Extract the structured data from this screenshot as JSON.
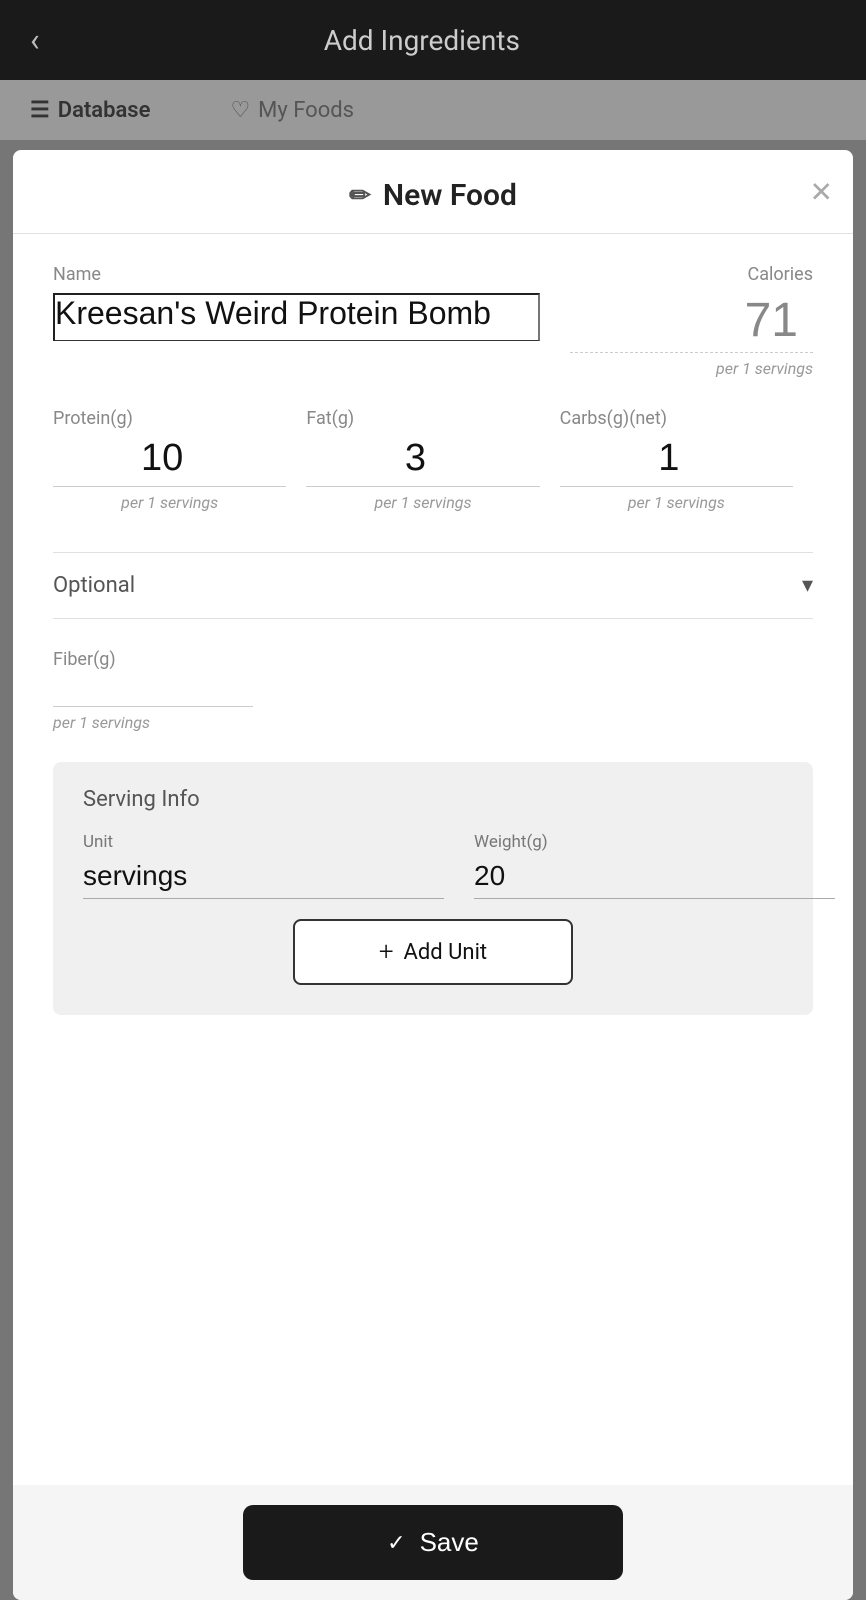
{
  "topBar": {
    "backLabel": "‹",
    "title": "Add Ingredients"
  },
  "tabs": [
    {
      "id": "database",
      "icon": "☰",
      "label": "Database",
      "active": true
    },
    {
      "id": "myfoods",
      "icon": "♡",
      "label": "My Foods",
      "active": false
    }
  ],
  "modal": {
    "closeIcon": "✕",
    "editIcon": "✏",
    "title": "New Food",
    "nameLabel": "Name",
    "nameValue": "Kreesan's Weird Protein Bomb",
    "caloriesLabel": "Calories",
    "caloriesValue": "71",
    "caloriesPerLabel": "per 1 servings",
    "proteinLabel": "Protein(g)",
    "proteinValue": "10",
    "proteinPerLabel": "per 1 servings",
    "fatLabel": "Fat(g)",
    "fatValue": "3",
    "fatPerLabel": "per 1 servings",
    "carbsLabel": "Carbs(g)(net)",
    "carbsValue": "1",
    "carbsPerLabel": "per 1 servings",
    "optionalLabel": "Optional",
    "chevronIcon": "▾",
    "fiberLabel": "Fiber(g)",
    "fiberValue": "",
    "fiberPerLabel": "per 1 servings",
    "servingInfoTitle": "Serving Info",
    "unitLabel": "Unit",
    "unitValue": "servings",
    "weightLabel": "Weight(g)",
    "weightValue": "20",
    "addUnitLabel": "Add Unit",
    "addUnitPlus": "+",
    "saveLabel": "Save",
    "saveCheck": "✓"
  }
}
